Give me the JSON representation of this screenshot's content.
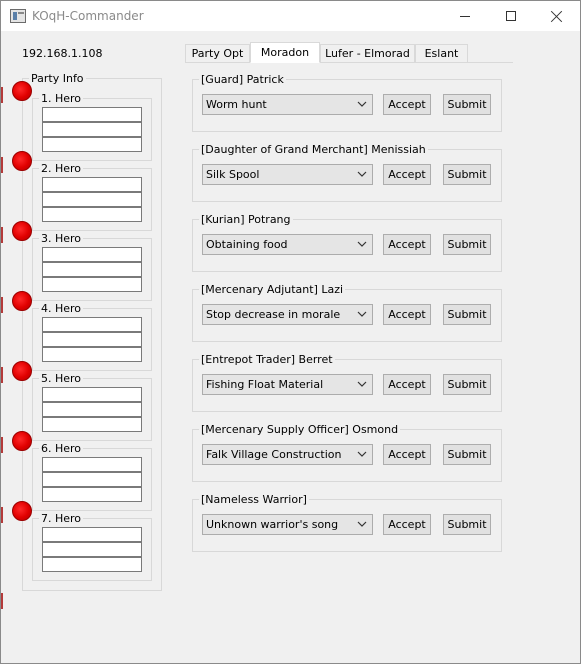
{
  "window": {
    "title": "KOqH-Commander"
  },
  "connection": {
    "ip": "192.168.1.108"
  },
  "tabs": [
    {
      "label": "Party Opt",
      "active": false
    },
    {
      "label": "Moradon",
      "active": true
    },
    {
      "label": "Lufer - Elmorad",
      "active": false
    },
    {
      "label": "Eslant",
      "active": false
    }
  ],
  "party": {
    "title": "Party Info",
    "heroes": [
      {
        "label": "1. Hero",
        "status_color": "#ff0000",
        "fields": [
          "",
          "",
          "",
          ""
        ]
      },
      {
        "label": "2. Hero",
        "status_color": "#ff0000",
        "fields": [
          "",
          "",
          "",
          ""
        ]
      },
      {
        "label": "3. Hero",
        "status_color": "#ff0000",
        "fields": [
          "",
          "",
          "",
          ""
        ]
      },
      {
        "label": "4. Hero",
        "status_color": "#ff0000",
        "fields": [
          "",
          "",
          "",
          ""
        ]
      },
      {
        "label": "5. Hero",
        "status_color": "#ff0000",
        "fields": [
          "",
          "",
          "",
          ""
        ]
      },
      {
        "label": "6. Hero",
        "status_color": "#ff0000",
        "fields": [
          "",
          "",
          "",
          ""
        ]
      },
      {
        "label": "7. Hero",
        "status_color": "#ff0000",
        "fields": [
          "",
          "",
          "",
          ""
        ]
      }
    ]
  },
  "quests": [
    {
      "npc": "[Guard] Patrick",
      "selected": "Worm hunt"
    },
    {
      "npc": "[Daughter of Grand Merchant] Menissiah",
      "selected": "Silk Spool"
    },
    {
      "npc": "[Kurian] Potrang",
      "selected": "Obtaining food"
    },
    {
      "npc": "[Mercenary Adjutant] Lazi",
      "selected": "Stop decrease in morale"
    },
    {
      "npc": "[Entrepot Trader] Berret",
      "selected": "Fishing Float Material"
    },
    {
      "npc": "[Mercenary Supply Officer] Osmond",
      "selected": "Falk Village Construction"
    },
    {
      "npc": "[Nameless Warrior]",
      "selected": "Unknown warrior's song"
    }
  ],
  "buttons": {
    "accept_label": "Accept",
    "submit_label": "Submit"
  }
}
